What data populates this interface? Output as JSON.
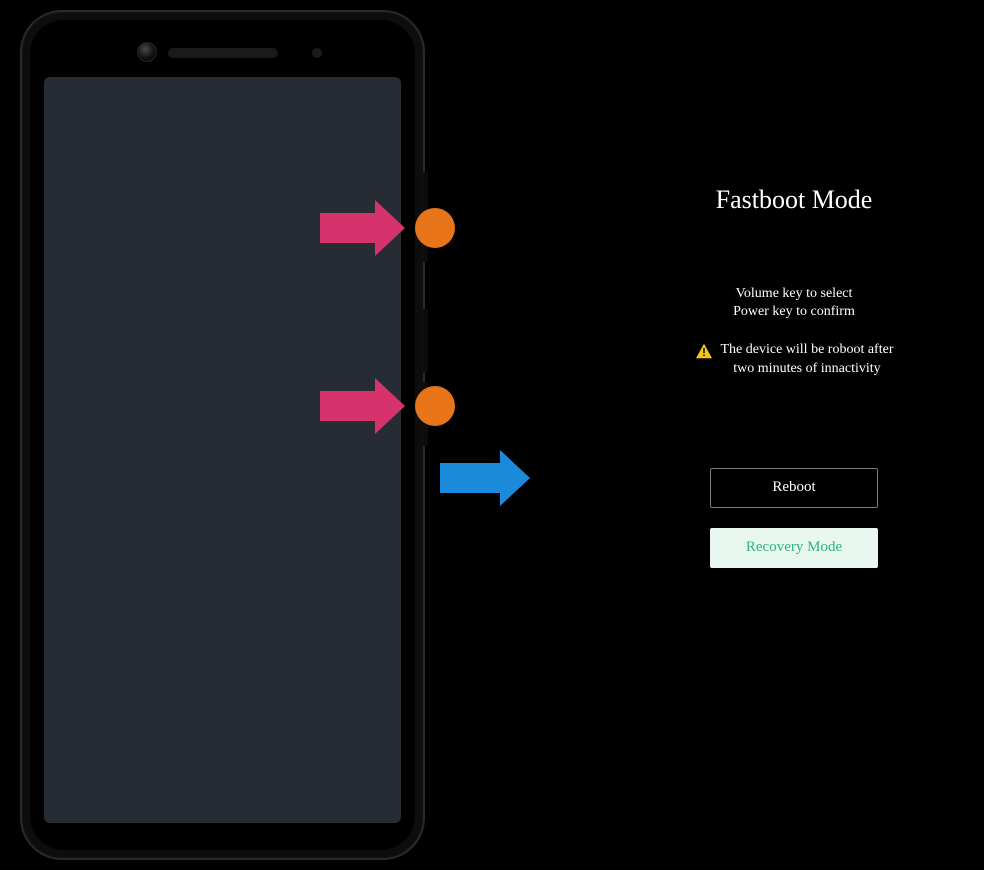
{
  "fastboot": {
    "title": "Fastboot Mode",
    "instruction_line1": "Volume key to select",
    "instruction_line2": "Power key to confirm",
    "warning_line1": "The device will be roboot after",
    "warning_line2": "two minutes of innactivity",
    "buttons": {
      "reboot": "Reboot",
      "recovery": "Recovery Mode"
    }
  },
  "indicators": {
    "arrow1": "press-volume-up",
    "arrow2": "press-power",
    "arrow3": "proceed-to-fastboot"
  },
  "colors": {
    "arrow_pink": "#d6336c",
    "arrow_blue": "#1c8adb",
    "dot_orange": "#e8751a",
    "screen_bg": "#262b34",
    "recovery_bg": "#e8f8f0",
    "recovery_text": "#2fb385"
  }
}
